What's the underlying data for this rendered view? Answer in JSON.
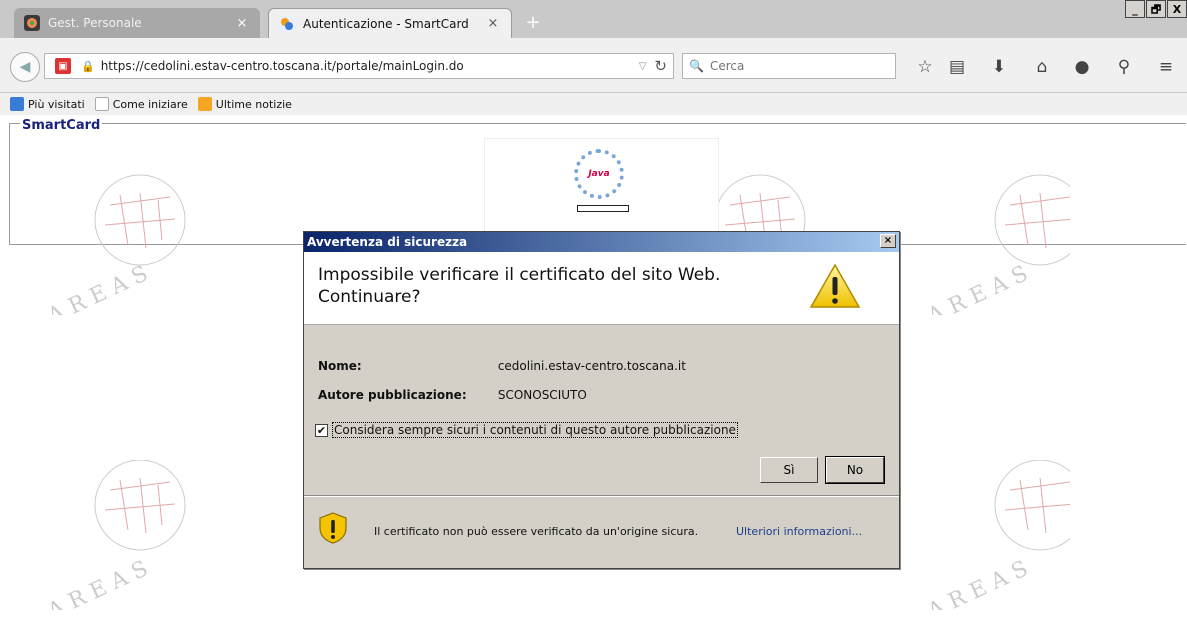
{
  "browser": {
    "tabs": [
      {
        "title": "Gest. Personale",
        "active": false
      },
      {
        "title": "Autenticazione - SmartCard",
        "active": true
      }
    ],
    "tab_close_glyph": "×",
    "new_tab_glyph": "+",
    "window_buttons": [
      "_",
      "🗗",
      "X"
    ],
    "url": "https://cedolini.estav-centro.toscana.it/portale/mainLogin.do",
    "search_placeholder": "Cerca",
    "toolbar_icons": [
      "star-icon",
      "reading-list-icon",
      "download-icon",
      "home-icon",
      "chat-icon",
      "search-icon",
      "menu-icon"
    ]
  },
  "bookmarks": [
    {
      "label": "Più visitati",
      "icon": "bookmark-icon",
      "color": "#3a7bd5"
    },
    {
      "label": "Come iniziare",
      "icon": "page-icon",
      "color": "#cccccc"
    },
    {
      "label": "Ultime notizie",
      "icon": "rss-icon",
      "color": "#f5a623"
    }
  ],
  "page": {
    "fieldset_legend": "SmartCard",
    "watermark_text": "AREAS",
    "applet_logo_text": "Java"
  },
  "dialog": {
    "title": "Avvertenza di sicurezza",
    "close_glyph": "×",
    "question": "Impossibile verificare il certificato del sito Web. Continuare?",
    "name_label": "Nome:",
    "name_value": "cedolini.estav-centro.toscana.it",
    "publisher_label": "Autore pubblicazione:",
    "publisher_value": "SCONOSCIUTO",
    "checkbox_label": "Considera sempre sicuri i contenuti di questo autore pubblicazione",
    "checkbox_checked": true,
    "check_glyph": "✔",
    "yes_button": "Sì",
    "no_button": "No",
    "footer_text": "Il certificato non può essere verificato da un'origine sicura.",
    "more_info_link": "Ulteriori informazioni..."
  }
}
